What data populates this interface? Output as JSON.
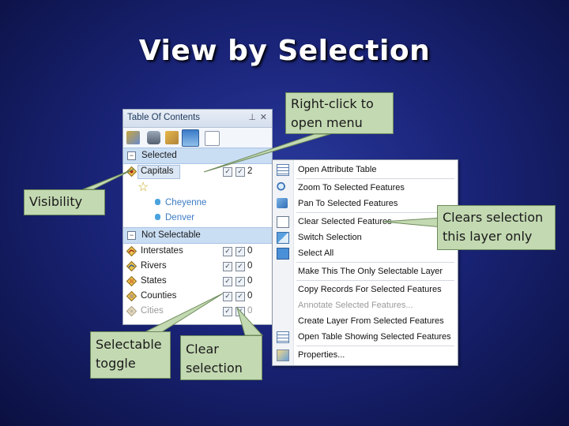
{
  "slide": {
    "title": "View by Selection"
  },
  "toc": {
    "header_title": "Table Of Contents",
    "pin_glyph": "⊥",
    "close_glyph": "✕",
    "groups": [
      {
        "label": "Selected"
      },
      {
        "label": "Not Selectable"
      }
    ],
    "selected_layer": {
      "label": "Capitals",
      "count": "2"
    },
    "selected_features": [
      "Cheyenne",
      "Denver"
    ],
    "not_selectable_layers": [
      {
        "label": "Interstates",
        "count": "0"
      },
      {
        "label": "Rivers",
        "count": "0"
      },
      {
        "label": "States",
        "count": "0"
      },
      {
        "label": "Counties",
        "count": "0"
      },
      {
        "label": "Cities",
        "count": "0"
      }
    ]
  },
  "menu": {
    "items": [
      {
        "label": "Open Attribute Table",
        "icon": "table-icon"
      },
      {
        "label": "Zoom To Selected Features",
        "icon": "zoom-icon"
      },
      {
        "label": "Pan To Selected Features",
        "icon": "pan-icon"
      },
      {
        "label": "Clear Selected Features",
        "icon": "clear-selection-icon"
      },
      {
        "label": "Switch Selection",
        "icon": "switch-selection-icon"
      },
      {
        "label": "Select All",
        "icon": "select-all-icon"
      },
      {
        "label": "Make This The Only Selectable Layer",
        "icon": ""
      },
      {
        "label": "Copy Records For Selected Features",
        "icon": ""
      },
      {
        "label": "Annotate Selected Features...",
        "icon": ""
      },
      {
        "label": "Create Layer From Selected Features",
        "icon": ""
      },
      {
        "label": "Open Table Showing Selected Features",
        "icon": "table-icon"
      },
      {
        "label": "Properties...",
        "icon": "properties-icon"
      }
    ]
  },
  "callouts": {
    "right_click": [
      "Right-click to",
      "open menu"
    ],
    "visibility": "Visibility",
    "clears": [
      "Clears selection",
      "this layer only"
    ],
    "selectable": [
      "Selectable",
      "toggle"
    ],
    "clear_selection": [
      "Clear",
      "selection"
    ]
  },
  "colors": {
    "background": "#1a2478",
    "callout": "#c3d9b2",
    "group_row": "#c9ddf3"
  }
}
